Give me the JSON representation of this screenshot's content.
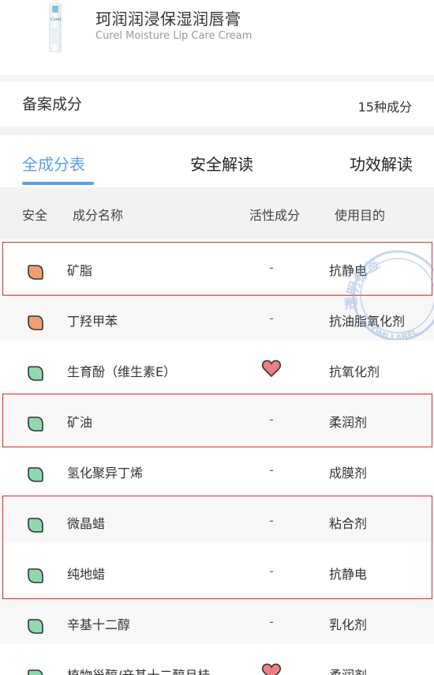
{
  "product": {
    "name": "珂润润浸保湿润唇膏",
    "name_en": "Curel Moisture Lip Care Cream",
    "package_logo": "Curél"
  },
  "filing": {
    "title": "备案成分",
    "count": "15种成分"
  },
  "tabs": [
    {
      "label": "全成分表",
      "active": true
    },
    {
      "label": "安全解读",
      "active": false
    },
    {
      "label": "功效解读",
      "active": false
    }
  ],
  "table": {
    "headers": {
      "safety": "安全",
      "name": "成分名称",
      "active": "活性成分",
      "purpose": "使用目的"
    },
    "rows": [
      {
        "safety": "orange",
        "name": "矿脂",
        "active": "-",
        "purpose": "抗静电"
      },
      {
        "safety": "orange",
        "name": "丁羟甲苯",
        "active": "-",
        "purpose": "抗油脂氧化剂"
      },
      {
        "safety": "green",
        "name": "生育酚（维生素E）",
        "active": "heart",
        "purpose": "抗氧化剂"
      },
      {
        "safety": "green",
        "name": "矿油",
        "active": "-",
        "purpose": "柔润剂"
      },
      {
        "safety": "green",
        "name": "氢化聚异丁烯",
        "active": "-",
        "purpose": "成膜剂"
      },
      {
        "safety": "green",
        "name": "微晶蜡",
        "active": "-",
        "purpose": "粘合剂"
      },
      {
        "safety": "green",
        "name": "纯地蜡",
        "active": "-",
        "purpose": "抗静电"
      },
      {
        "safety": "green",
        "name": "辛基十二醇",
        "active": "-",
        "purpose": "乳化剂"
      },
      {
        "safety": "green",
        "name": "植物甾醇/辛基十二醇月桂…",
        "active": "heart",
        "purpose": "柔润剂"
      }
    ]
  },
  "watermark": {
    "text_top": "透明标签",
    "text_bottom": "COMI LABEL"
  },
  "colors": {
    "accent": "#5aa0e6",
    "safety_orange": "#f0a070",
    "safety_green": "#8ed9b0",
    "heart": "#f08080",
    "highlight_border": "#e0282c"
  }
}
